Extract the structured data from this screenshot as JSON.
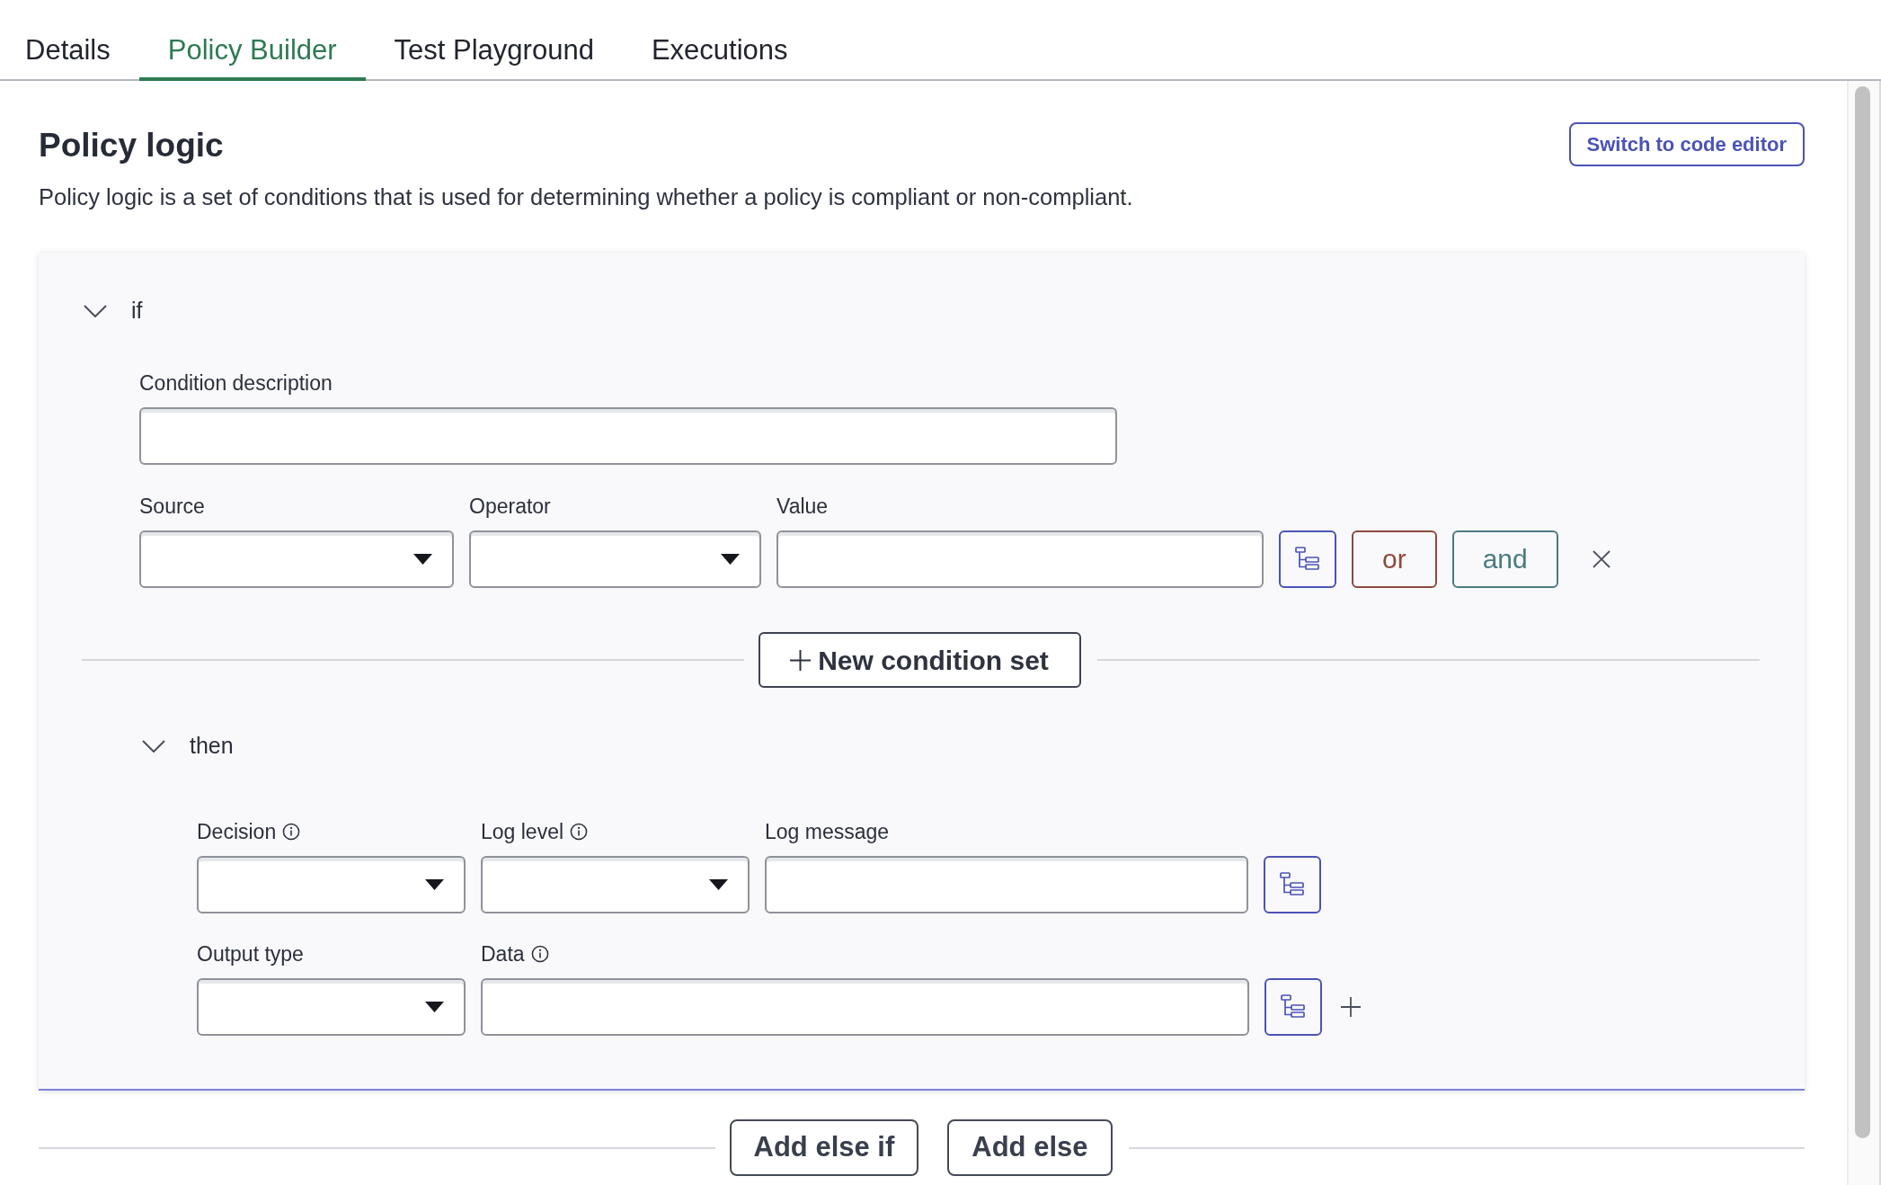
{
  "tabs": [
    {
      "label": "Details",
      "selected": false
    },
    {
      "label": "Policy Builder",
      "selected": true
    },
    {
      "label": "Test Playground",
      "selected": false
    },
    {
      "label": "Executions",
      "selected": false
    }
  ],
  "header": {
    "title": "Policy logic",
    "description": "Policy logic is a set of conditions that is used for determining whether a policy is compliant or non-compliant.",
    "code_editor_button": "Switch to code editor"
  },
  "if_block": {
    "keyword": "if",
    "expanded": true,
    "condition_description": {
      "label": "Condition description"
    },
    "condition": {
      "fields": [
        {
          "kind": "select",
          "label": "Source",
          "info": false
        },
        {
          "kind": "select",
          "label": "Operator",
          "info": false
        },
        {
          "kind": "text",
          "label": "Value",
          "info": false
        }
      ],
      "hierarchy_button": true,
      "connectors": [
        {
          "label": "or",
          "color": "#8b4a3d"
        },
        {
          "label": "and",
          "color": "#4a7b80"
        }
      ],
      "removable": true
    },
    "new_condition_set_button": "New condition set",
    "then": {
      "keyword": "then",
      "expanded": true,
      "rows": [
        {
          "fields": [
            {
              "kind": "select",
              "label": "Decision",
              "info": true
            },
            {
              "kind": "select",
              "label": "Log level",
              "info": true
            },
            {
              "kind": "text",
              "label": "Log message",
              "info": false
            }
          ],
          "hierarchy_button": true,
          "addable": false
        },
        {
          "fields": [
            {
              "kind": "select",
              "label": "Output type",
              "info": false
            },
            {
              "kind": "text",
              "label": "Data",
              "info": true
            }
          ],
          "hierarchy_button": true,
          "addable": true
        }
      ]
    }
  },
  "footer_buttons": [
    "Add else if",
    "Add else"
  ]
}
